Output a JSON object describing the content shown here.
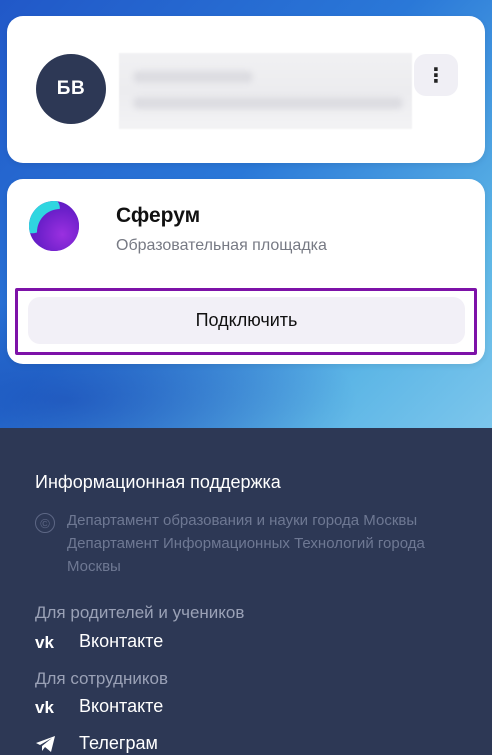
{
  "profile": {
    "initials": "БВ",
    "menu_icon": "more-vertical-icon"
  },
  "app": {
    "name": "Сферум",
    "subtitle": "Образовательная площадка",
    "connect_label": "Подключить"
  },
  "footer": {
    "title": "Информационная поддержка",
    "departments": [
      "Департамент образования и науки города Москвы",
      "Департамент Информационных Технологий города Москвы"
    ],
    "sections": [
      {
        "label": "Для родителей и учеников",
        "links": [
          {
            "label": "Вконтакте",
            "icon": "vk-icon"
          }
        ]
      },
      {
        "label": "Для сотрудников",
        "links": [
          {
            "label": "Вконтакте",
            "icon": "vk-icon"
          },
          {
            "label": "Телеграм",
            "icon": "telegram-icon"
          }
        ]
      }
    ]
  }
}
